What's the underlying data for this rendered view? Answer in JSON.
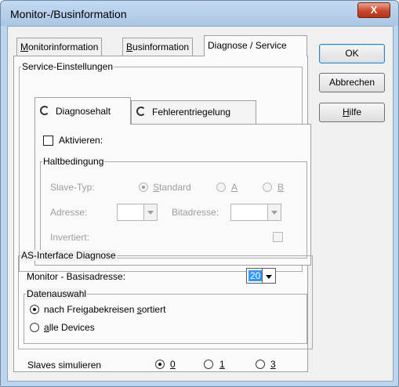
{
  "window": {
    "title": "Monitor-/Businformation",
    "close_glyph": "X"
  },
  "tabs": [
    {
      "label_underlined": "M",
      "label_rest": "onitorinformation"
    },
    {
      "label_underlined": "B",
      "label_rest": "usinformation"
    },
    {
      "label": "Diagnose / Service"
    }
  ],
  "buttons": {
    "ok": "OK",
    "abbrechen": "Abbrechen",
    "hilfe_u": "H",
    "hilfe_rest": "ilfe"
  },
  "service": {
    "group_title": "Service-Einstellungen",
    "subtabs": {
      "diagnosehalt": "Diagnosehalt",
      "fehlerentriegelung": "Fehlerentriegelung"
    },
    "aktivieren": "Aktivieren:",
    "haltbedingung": {
      "title": "Haltbedingung",
      "slave_typ": "Slave-Typ:",
      "opt_standard_u": "S",
      "opt_standard_rest": "tandard",
      "opt_a": "A",
      "opt_b": "B",
      "adresse": "Adresse:",
      "bitadresse": "Bitadresse:",
      "invertiert": "Invertiert:"
    }
  },
  "as_interface": {
    "title": "AS-Interface Diagnose",
    "monitor_label": "Monitor - Basisadresse:",
    "monitor_value": "20",
    "datenauswahl": {
      "title": "Datenauswahl",
      "opt1_pre": "nach Freigabekreisen ",
      "opt1_u": "s",
      "opt1_post": "ortiert",
      "opt2_u": "a",
      "opt2_rest": "lle Devices"
    }
  },
  "slaves": {
    "label": "Slaves simulieren",
    "opt0": "0",
    "opt1": "1",
    "opt3": "3"
  }
}
